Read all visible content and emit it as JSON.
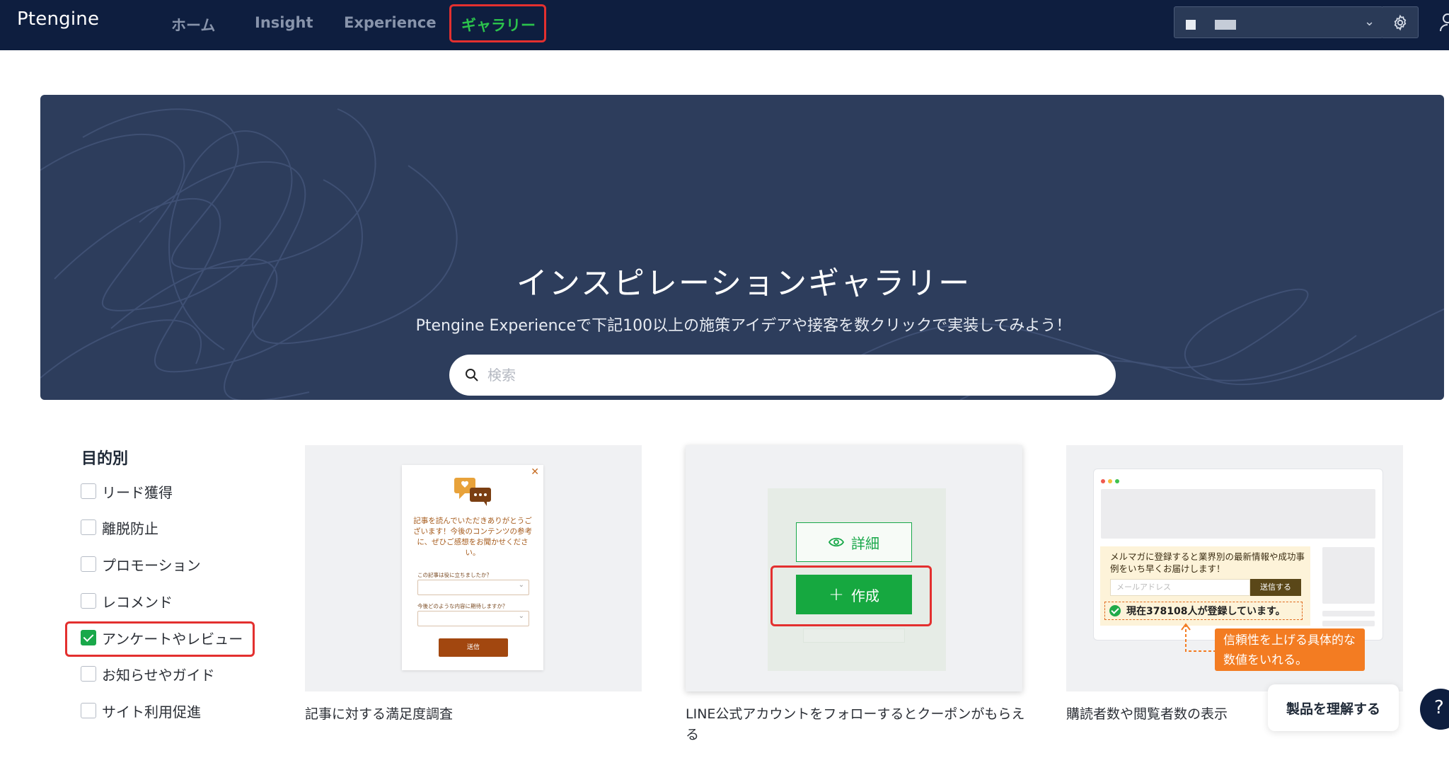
{
  "app": {
    "logo": "Ptengine"
  },
  "nav": {
    "items": [
      {
        "label": "ホーム"
      },
      {
        "label": "Insight"
      },
      {
        "label": "Experience"
      },
      {
        "label": "ギャラリー",
        "active": true
      }
    ]
  },
  "colors": {
    "nav_bg": "#0e1e3f",
    "accent_green": "#16a840",
    "highlight_red": "#e3302f",
    "hero_bg": "#2d3d5c",
    "callout_orange": "#f37c22"
  },
  "hero": {
    "title": "インスピレーションギャラリー",
    "subtitle": "Ptengine Experienceで下記100以上の施策アイデアや接客を数クリックで実装してみよう！",
    "search_placeholder": "検索"
  },
  "filter": {
    "title": "目的別",
    "items": [
      {
        "label": "リード獲得",
        "checked": false
      },
      {
        "label": "離脱防止",
        "checked": false
      },
      {
        "label": "プロモーション",
        "checked": false
      },
      {
        "label": "レコメンド",
        "checked": false
      },
      {
        "label": "アンケートやレビュー",
        "checked": true
      },
      {
        "label": "お知らせやガイド",
        "checked": false
      },
      {
        "label": "サイト利用促進",
        "checked": false
      }
    ]
  },
  "cards": [
    {
      "title": "記事に対する満足度調査",
      "preview": {
        "message": "記事を読んでいただきありがとうございます！今後のコンテンツの参考に、ぜひご感想をお聞かせください。",
        "question1": "この記事は役に立ちましたか？",
        "question2": "今後どのような内容に期待しますか？",
        "send_label": "送信"
      }
    },
    {
      "title": "LINE公式アカウントをフォローするとクーポンがもらえる",
      "detail_label": "詳細",
      "create_label": "作成"
    },
    {
      "title": "購読者数や閲覧者数の表示",
      "preview": {
        "message": "メルマガに登録すると業界別の最新情報や成功事例をいち早くお届けします！",
        "email_placeholder": "メールアドレス",
        "submit_label": "送信する",
        "count_text": "現在378108人が登録しています。",
        "callout": "信頼性を上げる具体的な数値をいれる。"
      }
    }
  ],
  "help": {
    "pill_label": "製品を理解する",
    "circle_label": "?"
  }
}
